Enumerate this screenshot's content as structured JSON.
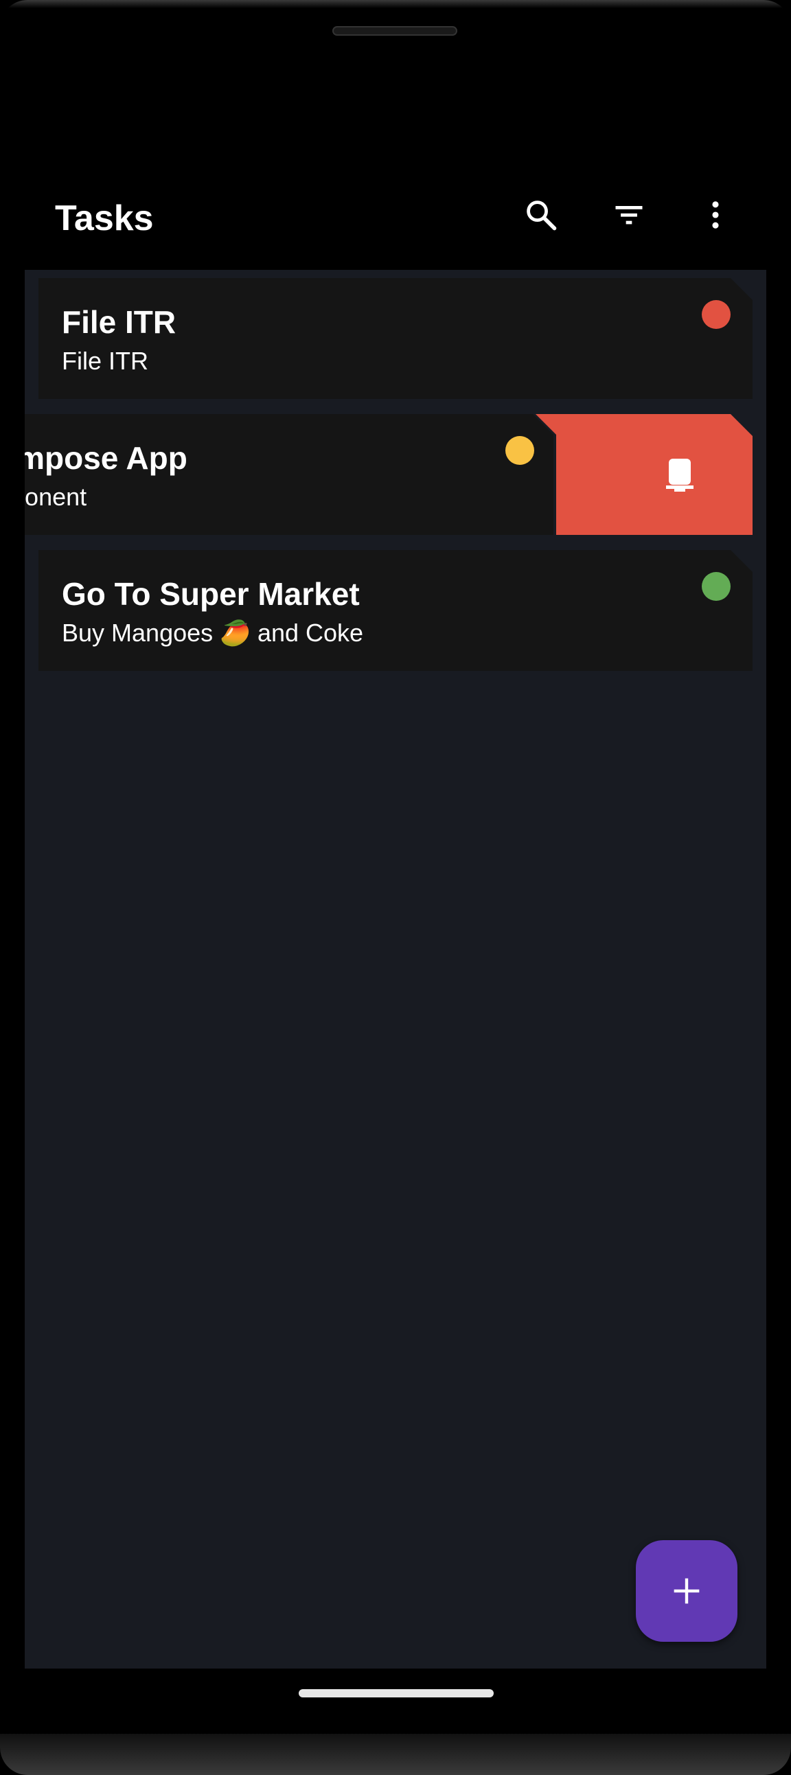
{
  "app_bar": {
    "title": "Tasks",
    "actions": [
      {
        "name": "search-icon",
        "label": "Search"
      },
      {
        "name": "filter-icon",
        "label": "Filter"
      },
      {
        "name": "more-vert-icon",
        "label": "More options"
      }
    ]
  },
  "tasks": [
    {
      "title": "File ITR",
      "description": "File ITR",
      "priority_color": "#e25241"
    },
    {
      "title": "ompose App",
      "description": "nponent",
      "priority_color": "#f9c244",
      "swiped": true
    },
    {
      "title": "Go To Super Market",
      "description": "Buy Mangoes 🥭 and Coke",
      "priority_color": "#63ac55"
    }
  ],
  "swipe_action": {
    "icon": "delete-icon",
    "color": "#e25241"
  },
  "fab": {
    "icon": "add-icon",
    "color": "#6139b4"
  },
  "colors": {
    "background": "#181b22",
    "card": "#151515",
    "app_bar": "#000000",
    "text": "#ffffff"
  }
}
